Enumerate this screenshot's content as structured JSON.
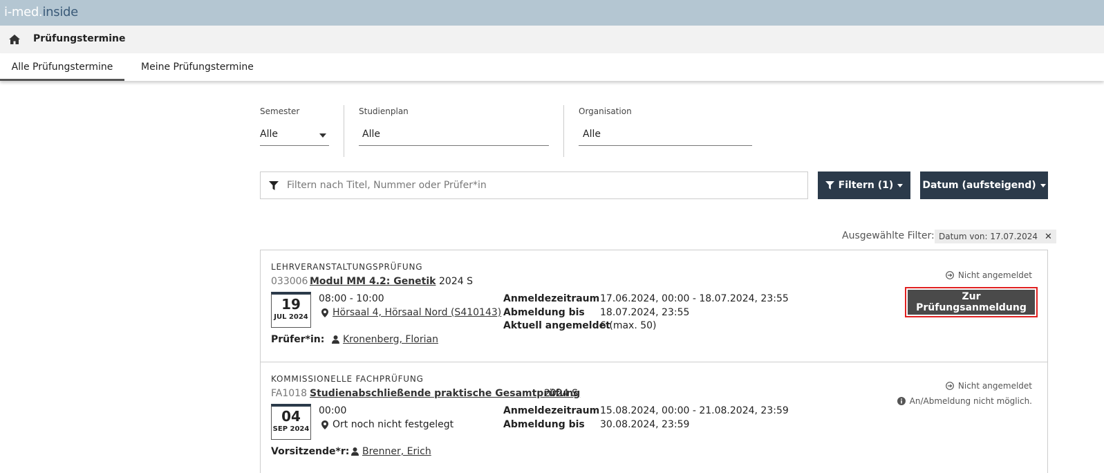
{
  "app": {
    "logo_part1": "i-med",
    "logo_dot": ".",
    "logo_part2": "inside"
  },
  "header": {
    "title": "Prüfungstermine"
  },
  "tabs": [
    {
      "label": "Alle Prüfungstermine",
      "active": true
    },
    {
      "label": "Meine Prüfungstermine",
      "active": false
    }
  ],
  "filters": {
    "semester": {
      "label": "Semester",
      "value": "Alle"
    },
    "studienplan": {
      "label": "Studienplan",
      "value": "Alle"
    },
    "organisation": {
      "label": "Organisation",
      "value": "Alle"
    }
  },
  "search": {
    "placeholder": "Filtern nach Titel, Nummer oder Prüfer*in",
    "value": ""
  },
  "buttons": {
    "filter_label": "Filtern (1)",
    "sort_label": "Datum (aufsteigend)"
  },
  "selected_filters": {
    "label": "Ausgewählte Filter:",
    "chips": [
      "Datum von: 17.07.2024"
    ]
  },
  "exams": [
    {
      "type": "LEHRVERANSTALTUNGSPRÜFUNG",
      "number": "033006",
      "title": "Modul MM 4.2: Genetik",
      "semester": "2024 S",
      "day": "19",
      "month_year": "JUL 2024",
      "time": "08:00 - 10:00",
      "location": "Hörsaal 4, Hörsaal Nord (S410143)",
      "details": [
        {
          "key": "Anmeldezeitraum",
          "value": "17.06.2024, 00:00 - 18.07.2024, 23:55"
        },
        {
          "key": "Abmeldung bis",
          "value": "18.07.2024, 23:55"
        },
        {
          "key": "Aktuell angemeldet",
          "value": "6 (max. 50)"
        }
      ],
      "person_label": "Prüfer*in:",
      "person": "Kronenberg, Florian",
      "status": "Nicht angemeldet",
      "action_label": "Zur Prüfungsanmeldung"
    },
    {
      "type": "KOMMISSIONELLE FACHPRÜFUNG",
      "number": "FA1018",
      "title": "Studienabschließende praktische Gesamtprüfung",
      "semester": "2024 S",
      "day": "04",
      "month_year": "SEP 2024",
      "time": "00:00",
      "location": "Ort noch nicht festgelegt",
      "details": [
        {
          "key": "Anmeldezeitraum",
          "value": "15.08.2024, 00:00 - 21.08.2024, 23:59"
        },
        {
          "key": "Abmeldung bis",
          "value": "30.08.2024, 23:59"
        }
      ],
      "person_label": "Vorsitzende*r:",
      "person": "Brenner, Erich",
      "status": "Nicht angemeldet",
      "info": "An/Abmeldung nicht möglich."
    }
  ],
  "colors": {
    "topbar": "#b4c6d2",
    "dark_button": "#2b3a4a",
    "register_button": "#4a4a4a",
    "highlight": "#e02020"
  }
}
